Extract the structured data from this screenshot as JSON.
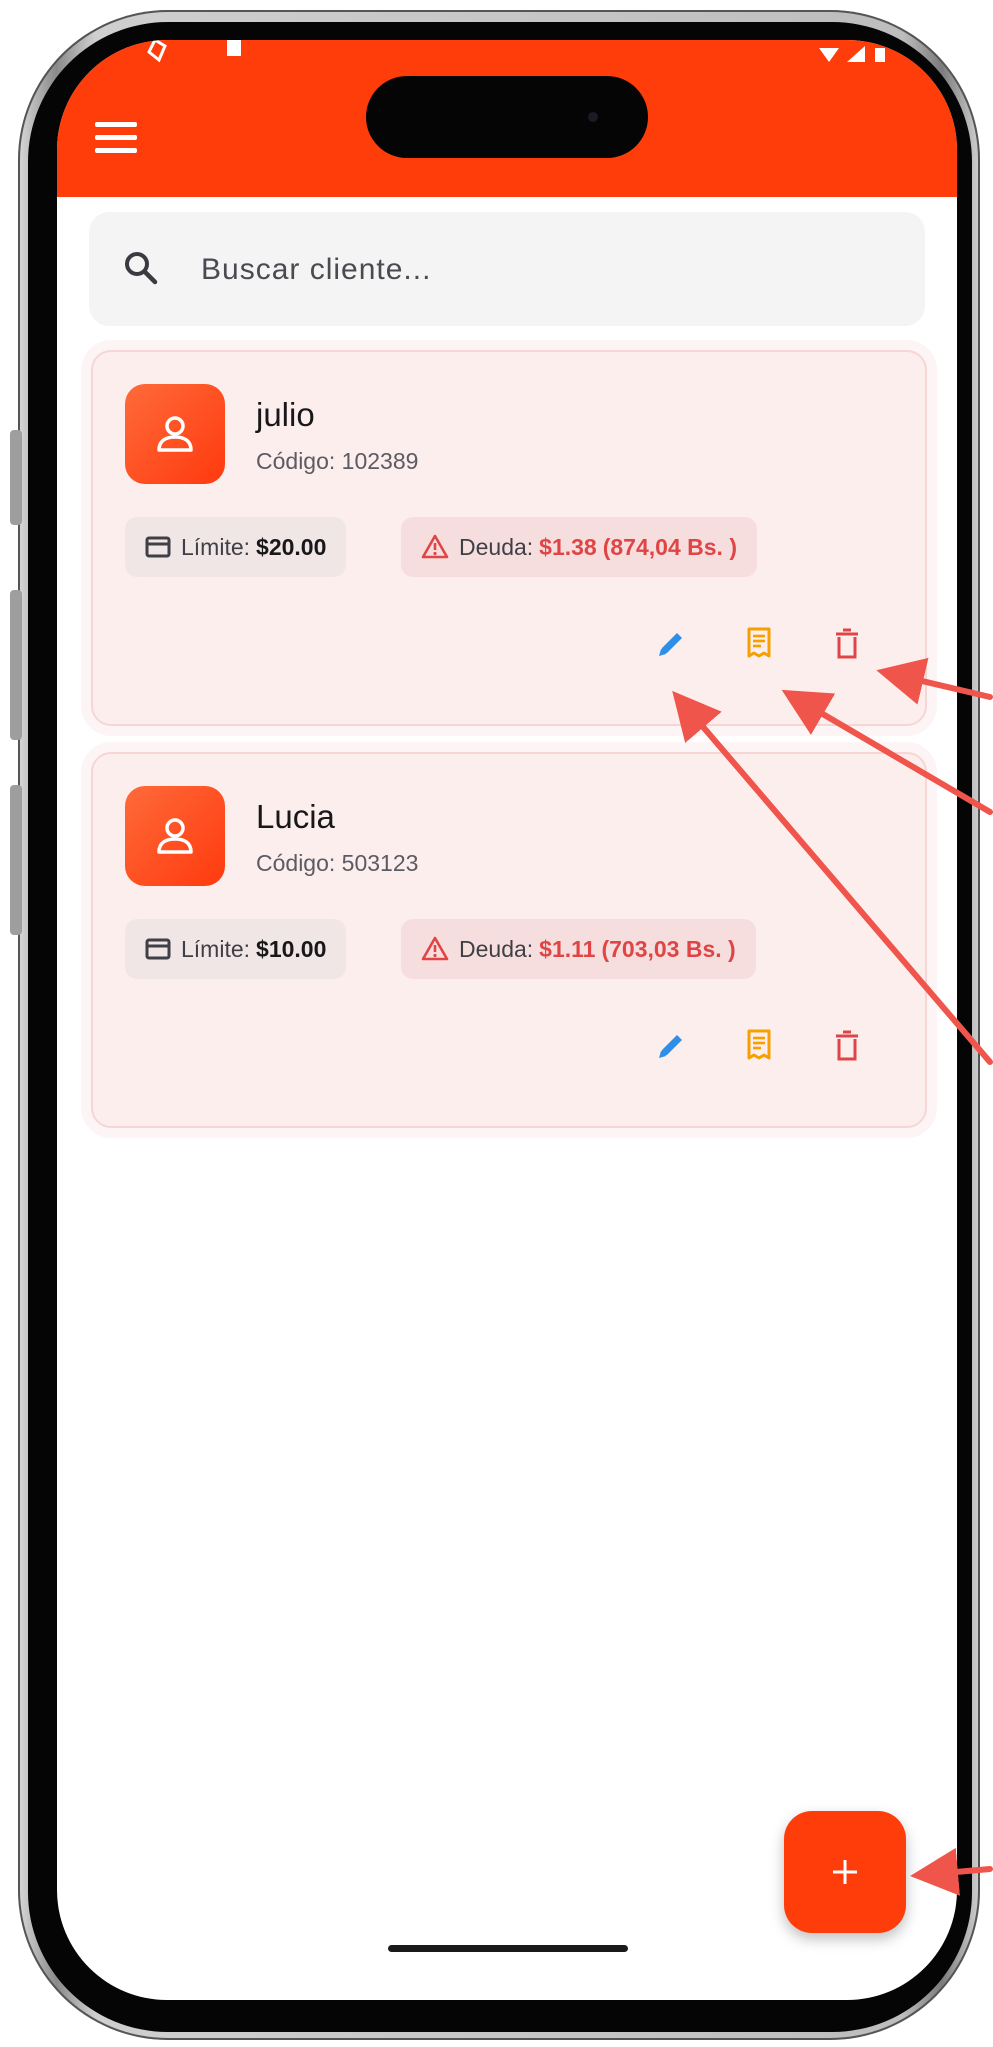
{
  "search": {
    "placeholder": "Buscar cliente..."
  },
  "customers": [
    {
      "name": "julio",
      "code": "Código: 102389",
      "limit_label": "Límite:",
      "limit_value": "$20.00",
      "debt_label": "Deuda:",
      "debt_value": "$1.38",
      "debt_bs": "(874,04 Bs. )"
    },
    {
      "name": "Lucia",
      "code": "Código: 503123",
      "limit_label": "Límite:",
      "limit_value": "$10.00",
      "debt_label": "Deuda:",
      "debt_value": "$1.11",
      "debt_bs": "(703,03 Bs. )"
    }
  ],
  "colors": {
    "brand": "#ff3d0a",
    "edit": "#2f8ee5",
    "receipt": "#f5a000",
    "delete": "#e04545",
    "annotation_arrow": "#f0554c"
  },
  "icons": [
    "menu-icon",
    "search-icon",
    "person-icon",
    "credit-card-icon",
    "warning-icon",
    "pencil-icon",
    "receipt-icon",
    "trash-icon",
    "plus-icon"
  ]
}
